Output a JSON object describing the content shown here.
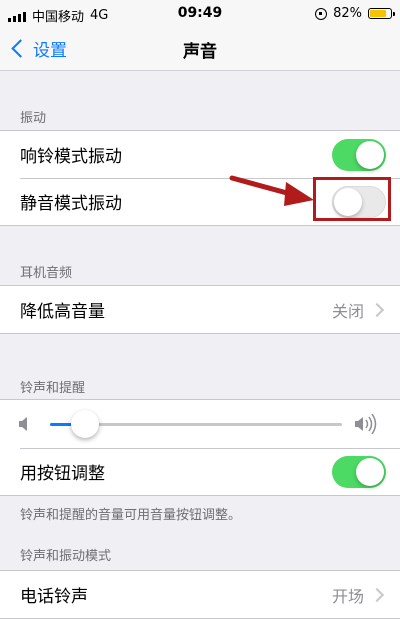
{
  "status_bar": {
    "carrier": "中国移动",
    "network": "4G",
    "time": "09:49",
    "battery_percent": "82%",
    "battery_level": 0.82
  },
  "nav": {
    "back_label": "设置",
    "title": "声音"
  },
  "sections": {
    "vibration": {
      "header": "振动",
      "rows": [
        {
          "label": "响铃模式振动",
          "toggle": true
        },
        {
          "label": "静音模式振动",
          "toggle": false
        }
      ]
    },
    "headphone": {
      "header": "耳机音频",
      "rows": [
        {
          "label": "降低高音量",
          "value": "关闭"
        }
      ]
    },
    "ringer": {
      "header": "铃声和提醒",
      "volume_level": 0.12,
      "rows": [
        {
          "label": "用按钮调整",
          "toggle": true
        }
      ],
      "footer": "铃声和提醒的音量可用音量按钮调整。"
    },
    "patterns": {
      "header": "铃声和振动模式",
      "rows": [
        {
          "label": "电话铃声",
          "value": "开场"
        }
      ]
    }
  },
  "colors": {
    "accent": "#0a7aff",
    "toggle_on": "#4cd964",
    "highlight": "#b11b1b"
  }
}
